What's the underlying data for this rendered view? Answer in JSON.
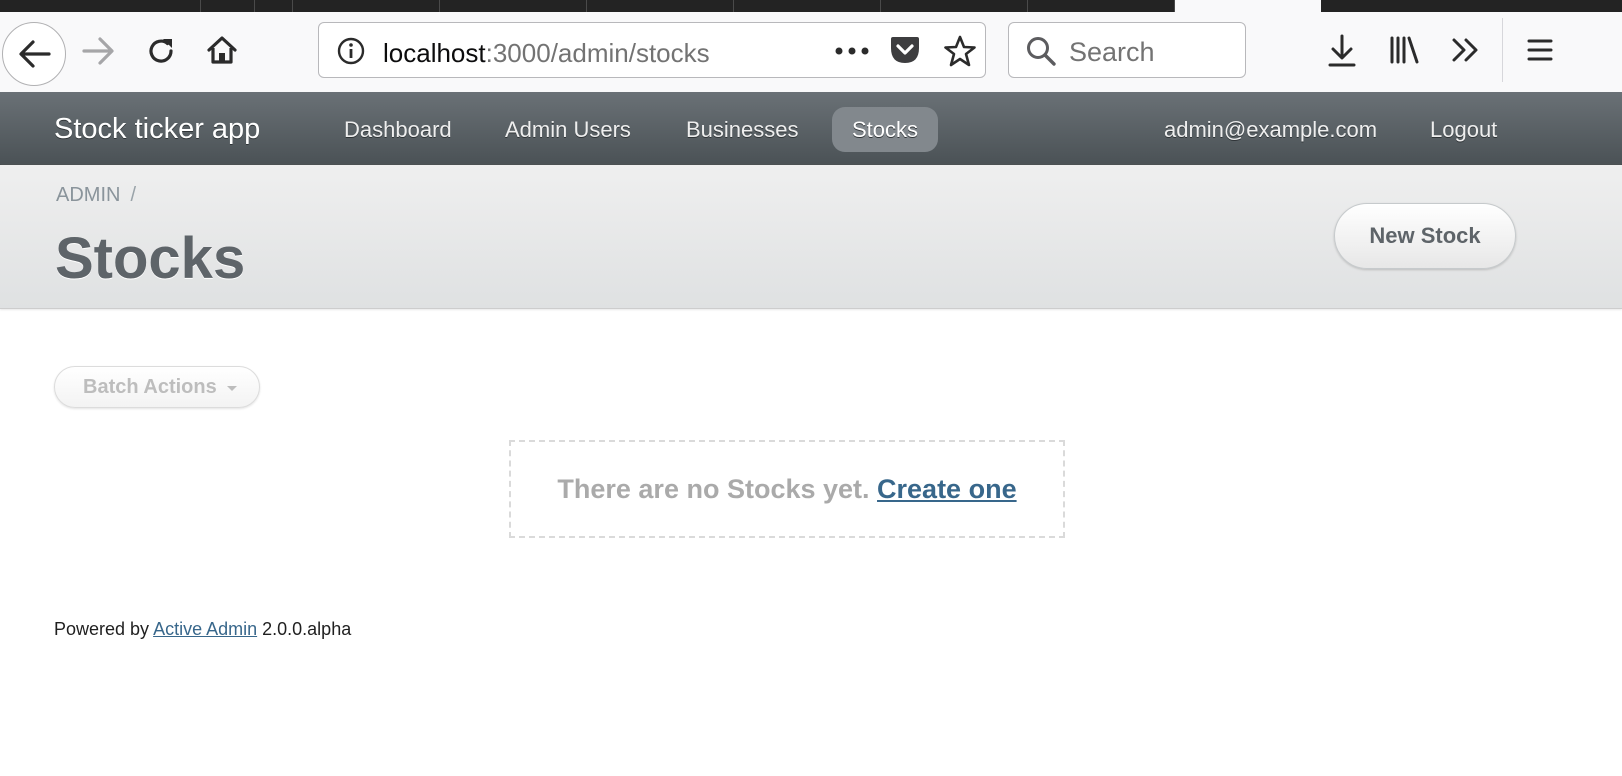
{
  "browser": {
    "url_host": "localhost",
    "url_path": ":3000/admin/stocks",
    "search_placeholder": "Search"
  },
  "header": {
    "site_title": "Stock ticker app",
    "nav": [
      "Dashboard",
      "Admin Users",
      "Businesses",
      "Stocks"
    ],
    "current_nav": "Stocks",
    "user_email": "admin@example.com",
    "logout_label": "Logout"
  },
  "title_bar": {
    "breadcrumb": "ADMIN",
    "breadcrumb_sep": "/",
    "page_title": "Stocks",
    "action_button": "New Stock"
  },
  "main": {
    "batch_actions_label": "Batch Actions",
    "empty_message": "There are no Stocks yet.",
    "create_link": "Create one"
  },
  "footer": {
    "prefix": "Powered by",
    "link": "Active Admin",
    "version": "2.0.0.alpha"
  },
  "colors": {
    "header_top": "#6a7176",
    "header_bottom": "#4b5256",
    "link": "#38678b",
    "title_text": "#5e6469"
  }
}
